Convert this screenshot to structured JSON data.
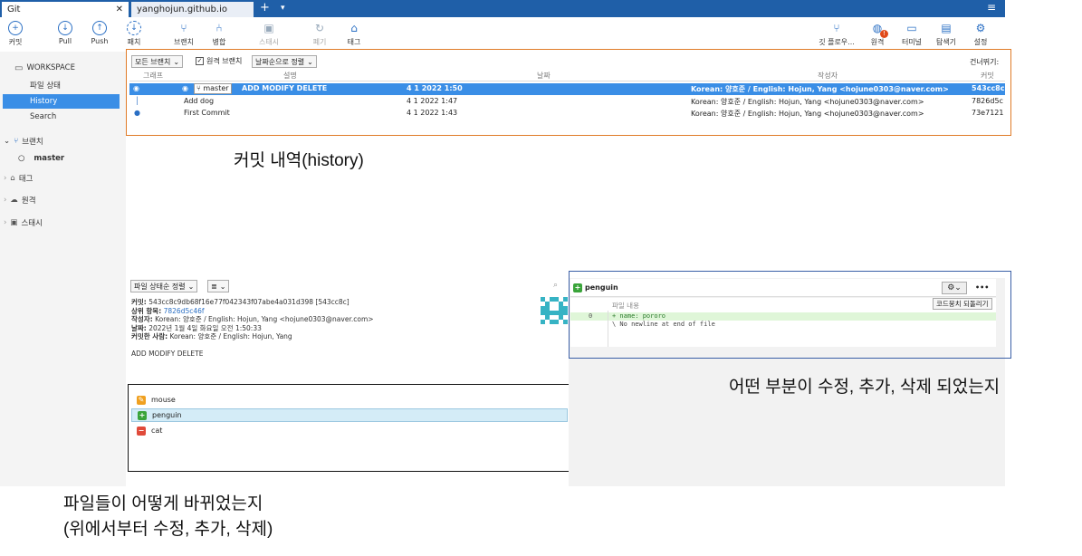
{
  "tabs": {
    "git": "Git",
    "close": "✕",
    "site": "yanghojun.github.io",
    "add": "+",
    "dropdown": "▾",
    "menu": "≡"
  },
  "toolbar": {
    "commit": "커밋",
    "pull": "Pull",
    "push": "Push",
    "fetch": "패치",
    "branch": "브랜치",
    "merge": "병합",
    "stash": "스태시",
    "discard": "폐기",
    "tag": "태그",
    "gitflow": "깃 플로우...",
    "remote": "원격",
    "terminal": "터미널",
    "explorer": "탐색기",
    "settings": "설정"
  },
  "sidebar": {
    "workspace": "WORKSPACE",
    "items": [
      "파일 상태",
      "History",
      "Search"
    ],
    "branches": "브랜치",
    "master": "master",
    "tags": "태그",
    "remotes": "원격",
    "stashes": "스태시"
  },
  "history": {
    "branch_filter": "모든 브랜치",
    "remote_branches": "원격 브랜치",
    "sort": "날짜순으로 정렬",
    "skip": "건너뛰기:",
    "columns": {
      "graph": "그래프",
      "desc": "설명",
      "date": "날짜",
      "author": "작성자",
      "commit": "커밋"
    },
    "rows": [
      {
        "branch": "master",
        "desc": "ADD MODIFY DELETE",
        "date": "4 1 2022 1:50",
        "author": "Korean: 양호준 / English: Hojun, Yang <hojune0303@naver.com>",
        "hash": "543cc8c"
      },
      {
        "desc": "Add dog",
        "date": "4 1 2022 1:47",
        "author": "Korean: 양호준 / English: Hojun, Yang <hojune0303@naver.com>",
        "hash": "7826d5c"
      },
      {
        "desc": "First Commit",
        "date": "4 1 2022 1:43",
        "author": "Korean: 양호준 / English: Hojun, Yang <hojune0303@naver.com>",
        "hash": "73e7121"
      }
    ]
  },
  "lower": {
    "file_sort": "파일 상태순 정렬",
    "view_mode": "≣",
    "commit_label": "커밋:",
    "commit_value": "543cc8c9db68f16e77f042343f07abe4a031d398 [543cc8c]",
    "parent_label": "상위 항목:",
    "parent_value": "7826d5c46f",
    "author_label": "작성자:",
    "author_value": "Korean: 양호준 / English: Hojun, Yang <hojune0303@naver.com>",
    "date_label": "날짜:",
    "date_value": "2022년 1월 4일 화요일 오전 1:50:33",
    "committer_label": "커밋한 사람:",
    "committer_value": "Korean: 양호준 / English: Hojun, Yang",
    "message": "ADD MODIFY DELETE",
    "files": [
      {
        "name": "mouse",
        "status": "modified",
        "color": "#f0a020",
        "glyph": "✎"
      },
      {
        "name": "penguin",
        "status": "added",
        "color": "#3aa43a",
        "glyph": "+"
      },
      {
        "name": "cat",
        "status": "removed",
        "color": "#e04a3a",
        "glyph": "−"
      }
    ]
  },
  "diff": {
    "file": "penguin",
    "content_label": "파일 내용",
    "revert": "코드뭉치 되돌리기",
    "more": "•••",
    "lines": [
      {
        "num": "0",
        "text": "+ name: pororo"
      },
      {
        "num": "",
        "text": "\\ No newline at end of file"
      }
    ]
  },
  "annotations": {
    "history": "커밋 내역(history)",
    "diff": "어떤 부분이 수정, 추가, 삭제 되었는지",
    "files_line1": "파일들이 어떻게 바뀌었는지",
    "files_line2": "(위에서부터 수정, 추가, 삭제)"
  },
  "colors": {
    "accent": "#3a8ee6",
    "tabbar": "#1f5fa8",
    "history_annot": "#e07b28",
    "diff_annot": "#3a5fa6"
  }
}
